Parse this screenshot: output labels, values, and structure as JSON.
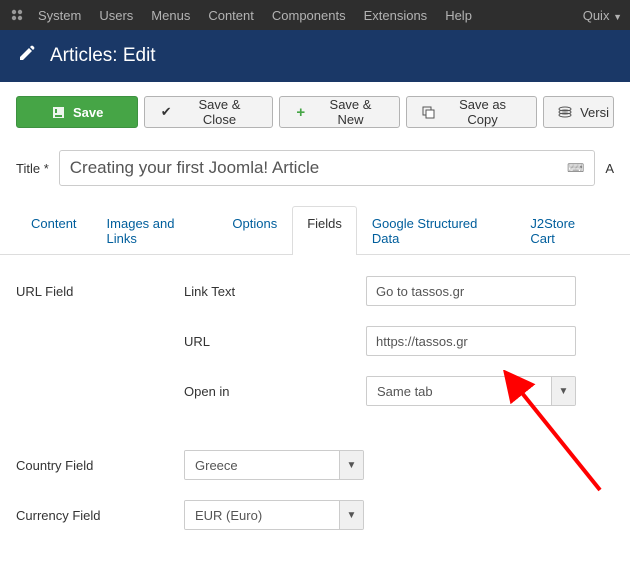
{
  "topmenu": {
    "items": [
      "System",
      "Users",
      "Menus",
      "Content",
      "Components",
      "Extensions",
      "Help"
    ],
    "right": "Quix"
  },
  "header": {
    "title": "Articles: Edit"
  },
  "toolbar": {
    "save": "Save",
    "save_close": "Save & Close",
    "save_new": "Save & New",
    "save_copy": "Save as Copy",
    "versions": "Versi"
  },
  "title_row": {
    "label": "Title *",
    "value": "Creating your first Joomla! Article",
    "alias_label": "A"
  },
  "tabs": [
    "Content",
    "Images and Links",
    "Options",
    "Fields",
    "Google Structured Data",
    "J2Store Cart"
  ],
  "tabs_active_index": 3,
  "fields": {
    "url_group_label": "URL Field",
    "link_text": {
      "label": "Link Text",
      "value": "Go to tassos.gr"
    },
    "url": {
      "label": "URL",
      "value": "https://tassos.gr"
    },
    "open_in": {
      "label": "Open in",
      "value": "Same tab"
    },
    "country": {
      "label": "Country Field",
      "value": "Greece"
    },
    "currency": {
      "label": "Currency Field",
      "value": "EUR (Euro)"
    }
  }
}
